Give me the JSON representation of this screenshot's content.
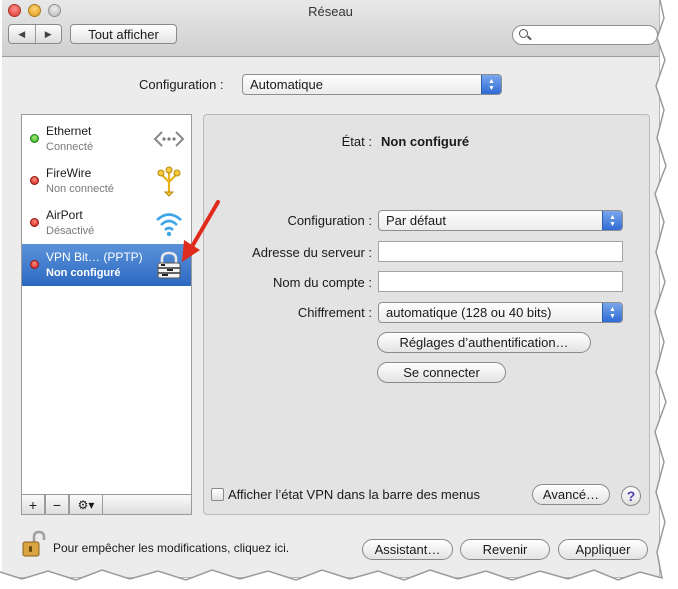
{
  "window": {
    "title": "Réseau"
  },
  "toolbar": {
    "show_all_label": "Tout afficher",
    "back_glyph": "◀",
    "forward_glyph": "▶",
    "search_placeholder": ""
  },
  "location": {
    "label": "Configuration :",
    "value": "Automatique"
  },
  "services": [
    {
      "name": "Ethernet",
      "status": "Connecté",
      "dot": "green",
      "icon": "ethernet-icon"
    },
    {
      "name": "FireWire",
      "status": "Non connecté",
      "dot": "red",
      "icon": "firewire-icon"
    },
    {
      "name": "AirPort",
      "status": "Désactivé",
      "dot": "red",
      "icon": "wifi-icon"
    },
    {
      "name": "VPN Bit… (PPTP)",
      "status": "Non configuré",
      "dot": "red",
      "icon": "vpn-lock-icon",
      "selected": true
    }
  ],
  "sidebar_bar": {
    "add": "+",
    "remove": "−",
    "gear": "⚙▾"
  },
  "detail": {
    "state_label": "État :",
    "state_value": "Non configuré",
    "configuration_label": "Configuration :",
    "configuration_value": "Par défaut",
    "server_label": "Adresse du serveur :",
    "server_value": "",
    "account_label": "Nom du compte :",
    "account_value": "",
    "encryption_label": "Chiffrement :",
    "encryption_value": "automatique (128 ou 40 bits)",
    "auth_button": "Réglages d’authentification…",
    "connect_button": "Se connecter",
    "show_status_label": "Afficher l’état VPN dans la barre des menus",
    "advanced_button": "Avancé…",
    "help": "?"
  },
  "footer": {
    "lock_text": "Pour empêcher les modifications, cliquez ici.",
    "assistant_button": "Assistant…",
    "revert_button": "Revenir",
    "apply_button": "Appliquer"
  },
  "colors": {
    "selection": "#2d69c1",
    "popup_arrow": "#2e6bd6",
    "annotation_arrow": "#e02a1c"
  }
}
